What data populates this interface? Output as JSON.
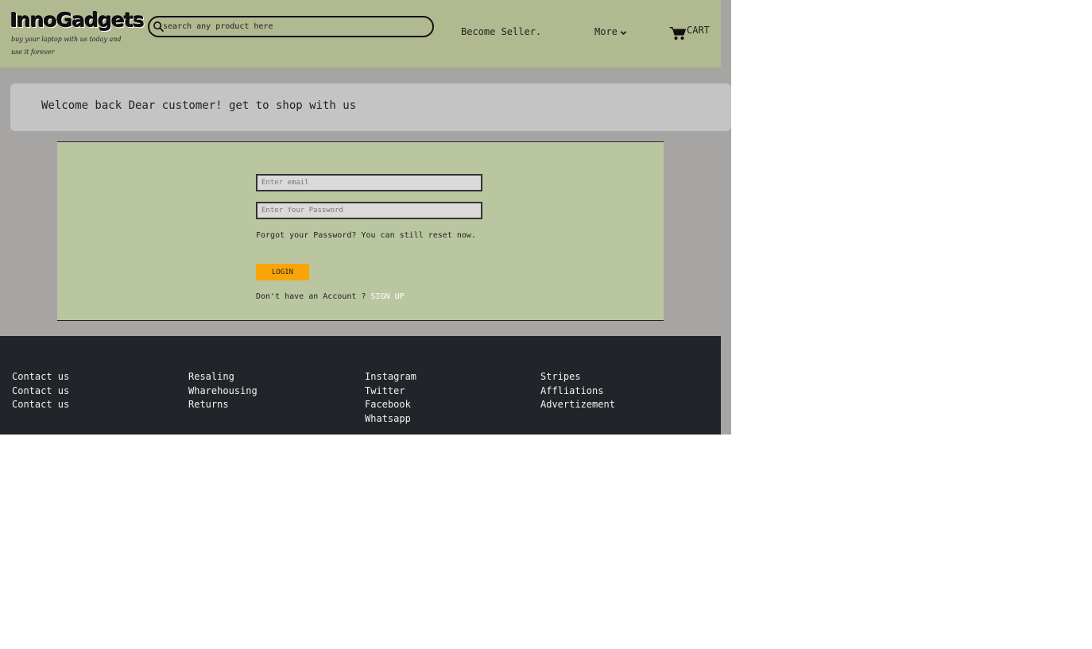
{
  "header": {
    "logo": "InnoGadgets",
    "tagline": "buy your laptop with us today and use it forever",
    "search_placeholder": "search any product here",
    "become_seller": "Become Seller.",
    "more": "More",
    "cart": "CART"
  },
  "welcome": "Welcome back Dear customer! get to shop with us",
  "login": {
    "email_placeholder": "Enter email",
    "password_placeholder": "Enter Your Password",
    "forgot": "Forgot your Password? You can still reset now.",
    "button": "LOGIN",
    "no_account": "Don't have an Account ? ",
    "signup": "SIGN UP"
  },
  "footer": {
    "columns": [
      [
        "Contact us",
        "Contact us",
        "Contact us"
      ],
      [
        "Resaling",
        "Wharehousing",
        "Returns"
      ],
      [
        "Instagram",
        "Twitter",
        "Facebook",
        "Whatsapp"
      ],
      [
        "Stripes",
        "Affliations",
        "Advertizement"
      ]
    ]
  },
  "colors": {
    "header_bg": "#b0b98f",
    "panel_bg": "#bac6a0",
    "login_button": "#f9a409",
    "footer_bg": "#212429"
  },
  "icons": [
    "search-icon",
    "chevron-down-icon",
    "cart-icon"
  ]
}
